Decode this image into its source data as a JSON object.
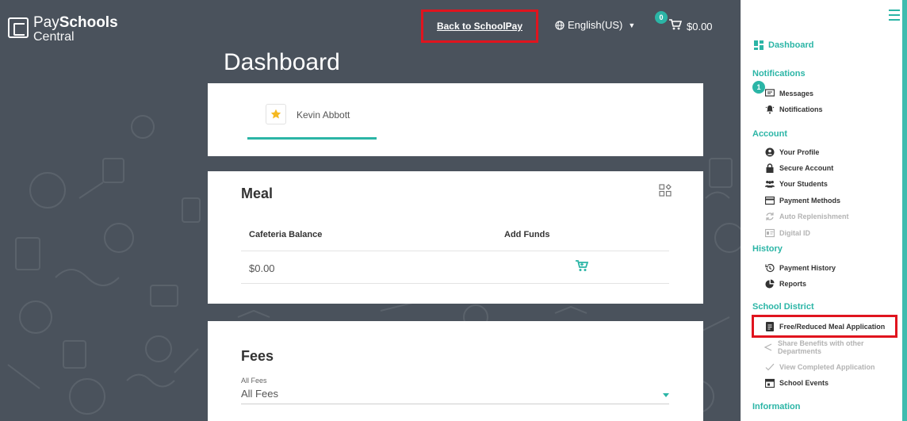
{
  "logo": {
    "line1_thin": "Pay",
    "line1_bold": "Schools",
    "line2": "Central"
  },
  "topbar": {
    "back_link": "Back to SchoolPay",
    "language": "English(US)",
    "cart_count": "0",
    "cart_total": "$0.00"
  },
  "page": {
    "title": "Dashboard"
  },
  "student": {
    "name": "Kevin Abbott"
  },
  "meal": {
    "title": "Meal",
    "col_balance": "Cafeteria Balance",
    "col_funds": "Add Funds",
    "balance": "$0.00"
  },
  "fees": {
    "title": "Fees",
    "label": "All Fees",
    "selected": "All Fees"
  },
  "sidebar": {
    "dashboard": "Dashboard",
    "sections": {
      "notifications": "Notifications",
      "account": "Account",
      "history": "History",
      "school_district": "School District",
      "information": "Information"
    },
    "messages_badge": "1",
    "items": {
      "messages": "Messages",
      "notifications": "Notifications",
      "your_profile": "Your Profile",
      "secure_account": "Secure Account",
      "your_students": "Your Students",
      "payment_methods": "Payment Methods",
      "auto_replenishment": "Auto Replenishment",
      "digital_id": "Digital ID",
      "payment_history": "Payment History",
      "reports": "Reports",
      "free_reduced": "Free/Reduced Meal Application",
      "share_benefits_1": "Share Benefits with other",
      "share_benefits_2": "Departments",
      "view_completed": "View Completed Application",
      "school_events": "School Events"
    }
  },
  "colors": {
    "accent": "#2bb5a6",
    "background": "#4a525c",
    "highlight": "#e0141e"
  }
}
